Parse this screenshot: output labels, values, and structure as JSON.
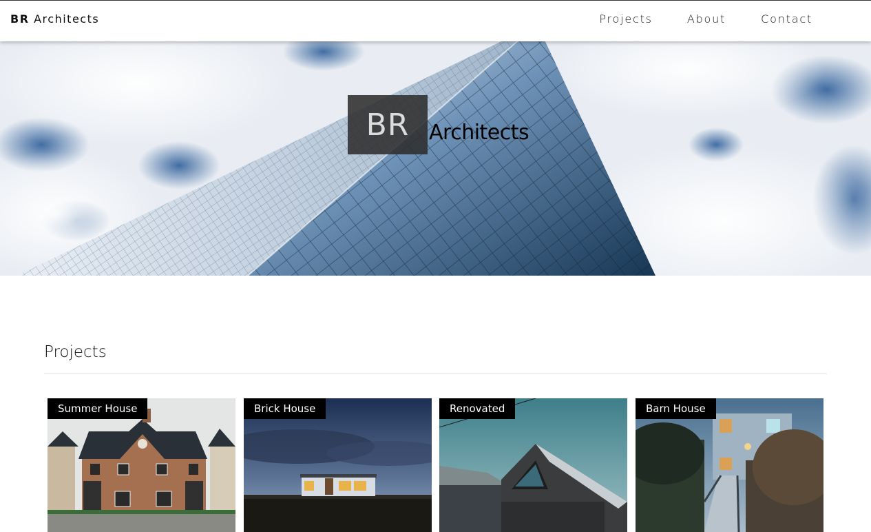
{
  "header": {
    "brand_bold": "BR",
    "brand_rest": "Architects",
    "nav": [
      "Projects",
      "About",
      "Contact"
    ]
  },
  "hero": {
    "logo_badge": "BR",
    "logo_word": "Architects"
  },
  "projects": {
    "title": "Projects",
    "items": [
      {
        "label": "Summer House"
      },
      {
        "label": "Brick House"
      },
      {
        "label": "Renovated"
      },
      {
        "label": "Barn House"
      }
    ]
  },
  "colors": {
    "tag_bg": "#000000",
    "nav_bg": "#ffffff",
    "logo_badge_bg": "#2d2d2d"
  }
}
